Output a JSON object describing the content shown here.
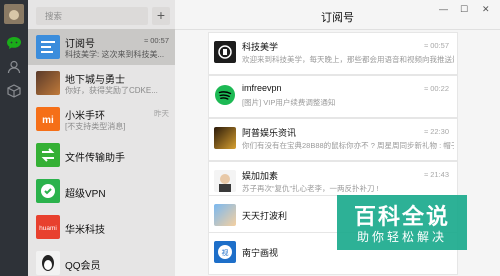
{
  "search": {
    "placeholder": "搜索"
  },
  "add_label": "+",
  "header": {
    "title": "订阅号",
    "min": "—",
    "max": "☐",
    "close": "✕"
  },
  "chats": [
    {
      "name": "订阅号",
      "msg": "科技美学: 这次来到科技美...",
      "time": "≈ 00:57",
      "selected": true
    },
    {
      "name": "地下城与勇士",
      "msg": "你好，获得奖励了CDKE...",
      "time": "",
      "selected": false
    },
    {
      "name": "小米手环",
      "msg": "[不支持类型消息]",
      "time": "昨天",
      "selected": false
    },
    {
      "name": "文件传输助手",
      "msg": "",
      "time": "",
      "selected": false
    },
    {
      "name": "超级VPN",
      "msg": "",
      "time": "",
      "selected": false
    },
    {
      "name": "华米科技",
      "msg": "",
      "time": "",
      "selected": false
    },
    {
      "name": "QQ会员",
      "msg": "",
      "time": "",
      "selected": false
    }
  ],
  "subscriptions": [
    {
      "name": "科技美学",
      "msg": "欢迎来到科技美学，每天晚上，那些都会用语音和视频向我推送最...",
      "time": "≈ 00:57"
    },
    {
      "name": "imfreevpn",
      "msg": "[图片] VIP用户续费调整通知",
      "time": "≈ 00:22"
    },
    {
      "name": "阿普娱乐资讯",
      "msg": "你们有没有在宝典28B88的鼠标你亦不 ? 周星周同步新礼物 : 帽子 ?",
      "time": "≈ 22:30"
    },
    {
      "name": "娱加加素",
      "msg": "苏子再次“复仇”扎心老李，一两反扑补刀 !",
      "time": "≈ 21:43"
    },
    {
      "name": "天天打波利",
      "msg": "",
      "time": ""
    },
    {
      "name": "南宁画视",
      "msg": "",
      "time": ""
    }
  ],
  "watermark": {
    "line1": "百科全说",
    "line2": "助你轻松解决"
  },
  "colors": {
    "sidebar": "#2e3238",
    "accent": "#1aad19",
    "watermark": "#16a88b"
  }
}
